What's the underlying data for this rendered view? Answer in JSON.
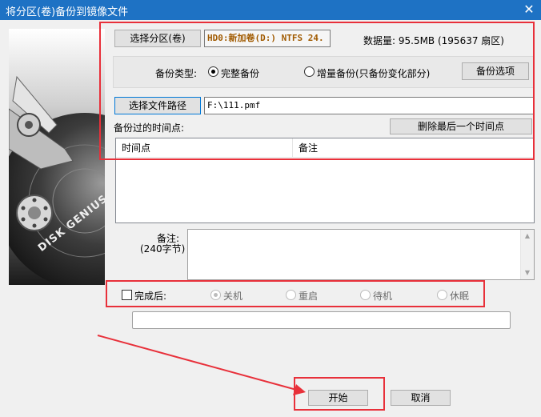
{
  "window": {
    "title": "将分区(卷)备份到镜像文件",
    "close_glyph": "✕"
  },
  "art": {
    "brand_text": "DISK GENIUS"
  },
  "source": {
    "select_partition_label": "选择分区(卷)",
    "partition_value": "HD0:新加卷(D:) NTFS 24.",
    "data_size_label": "数据量: 95.5MB (195637 扇区)"
  },
  "backup_type": {
    "label": "备份类型:",
    "full_label": "完整备份",
    "full_checked": true,
    "incremental_label": "增量备份(只备份变化部分)",
    "incremental_checked": false,
    "options_button": "备份选项"
  },
  "path": {
    "select_path_label": "选择文件路径",
    "path_value": "F:\\111.pmf"
  },
  "timepoints": {
    "label": "备份过的时间点:",
    "delete_last_button": "删除最后一个时间点",
    "columns": [
      "时间点",
      "备注"
    ]
  },
  "note": {
    "label_line1": "备注:",
    "label_line2": "(240字节)",
    "value": ""
  },
  "after_completion": {
    "label": "完成后:",
    "checked": false,
    "options": [
      {
        "label": "关机",
        "checked": true
      },
      {
        "label": "重启",
        "checked": false
      },
      {
        "label": "待机",
        "checked": false
      },
      {
        "label": "休眠",
        "checked": false
      }
    ]
  },
  "progress": {
    "value": ""
  },
  "actions": {
    "start_button": "开始",
    "cancel_button": "取消"
  },
  "annotation": {
    "highlight_color": "#e8303a"
  }
}
